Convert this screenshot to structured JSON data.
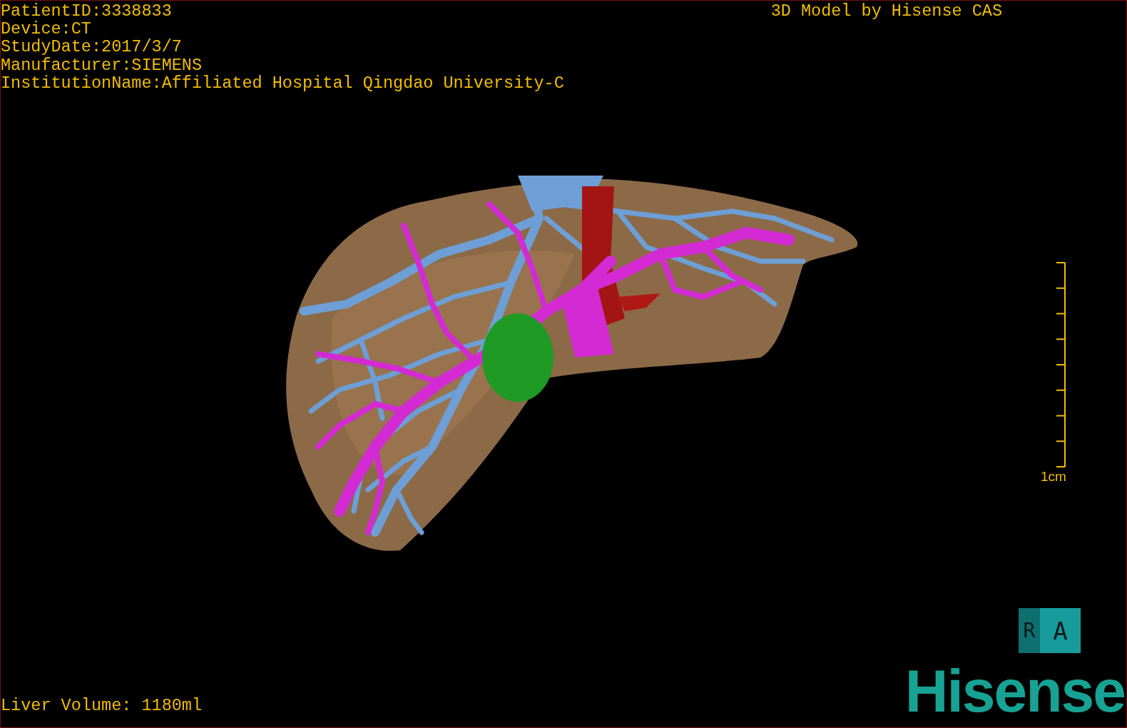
{
  "header": {
    "info_lines": [
      "PatientID:3338833",
      "Device:CT",
      "StudyDate:2017/3/7",
      "Manufacturer:SIEMENS",
      "InstitutionName:Affiliated Hospital Qingdao University-C"
    ],
    "title": "3D Model by Hisense CAS"
  },
  "scale_bar": {
    "label": "1cm"
  },
  "orientation_cube": {
    "faces": [
      "R",
      "A"
    ]
  },
  "footer": {
    "liver_volume": "Liver Volume: 1180ml"
  },
  "logo": {
    "text": "Hisense"
  }
}
